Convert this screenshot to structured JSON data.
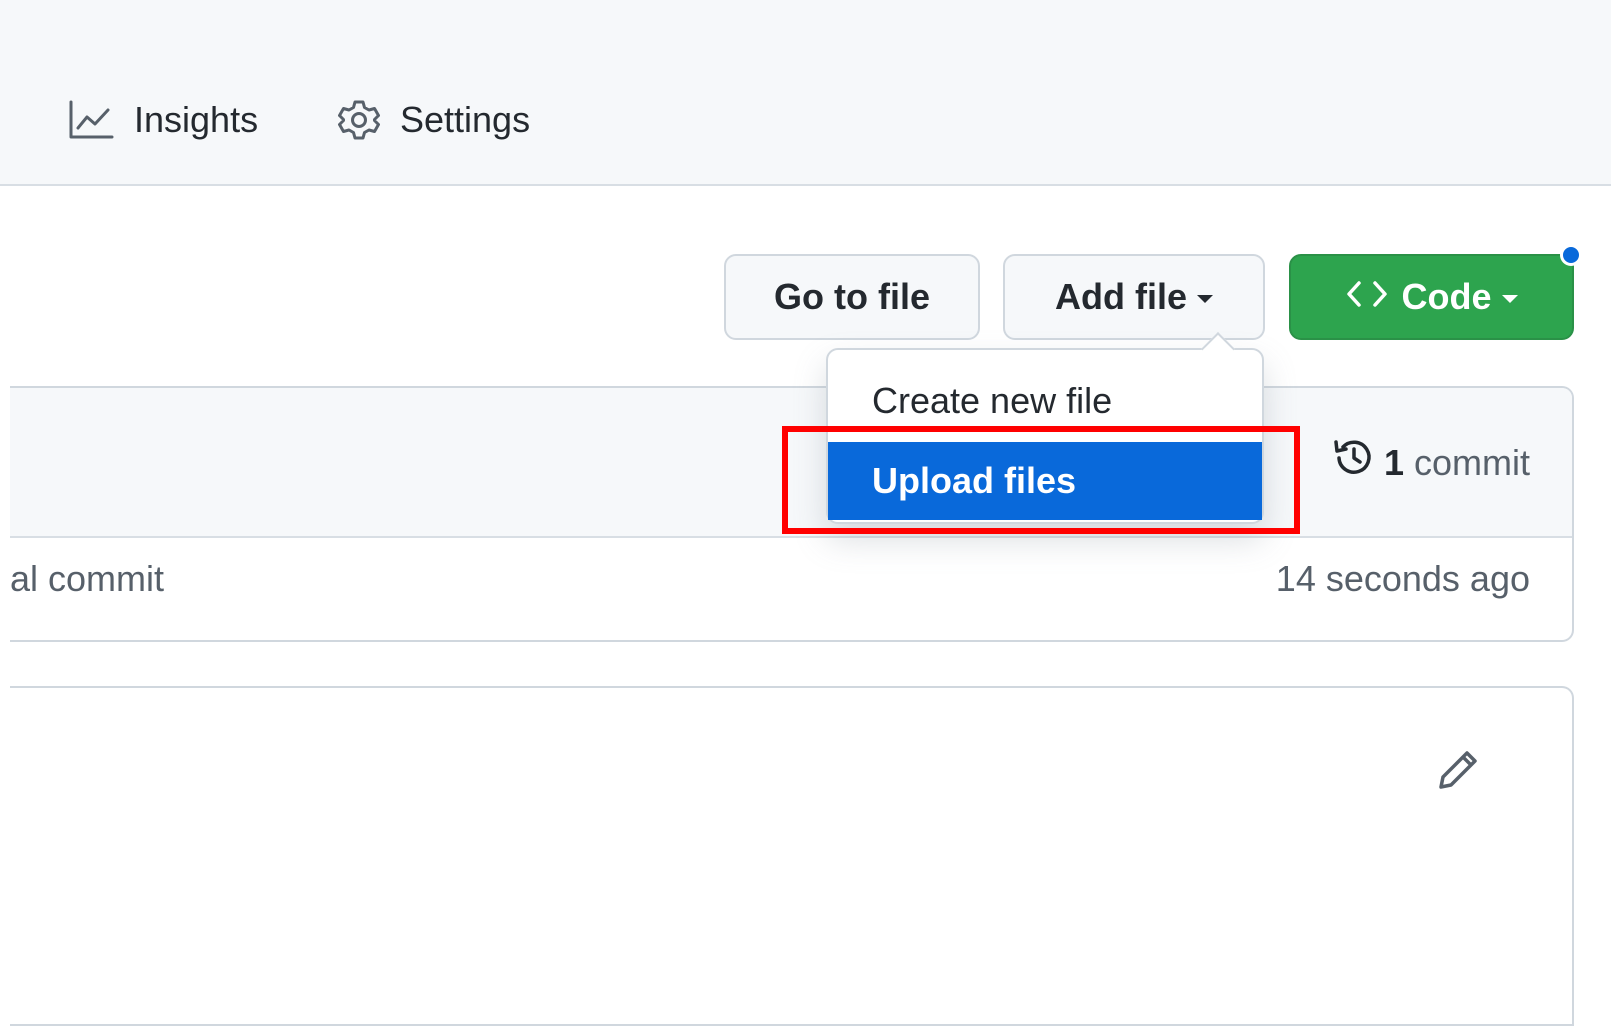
{
  "nav": {
    "items": [
      {
        "label": "Insights",
        "icon": "graph-icon"
      },
      {
        "label": "Settings",
        "icon": "gear-icon"
      }
    ]
  },
  "actions": {
    "go_to_file": "Go to file",
    "add_file": "Add file",
    "code": "Code"
  },
  "add_file_menu": {
    "items": [
      {
        "label": "Create new file",
        "selected": false
      },
      {
        "label": "Upload files",
        "selected": true
      }
    ]
  },
  "commits": {
    "count": "1",
    "word": "commit",
    "last_message": "al commit",
    "last_time": "14 seconds ago"
  },
  "colors": {
    "accent_blue": "#0969da",
    "code_green": "#2da44e",
    "highlight_red": "#ff0000",
    "nav_bg": "#f6f8fa"
  }
}
